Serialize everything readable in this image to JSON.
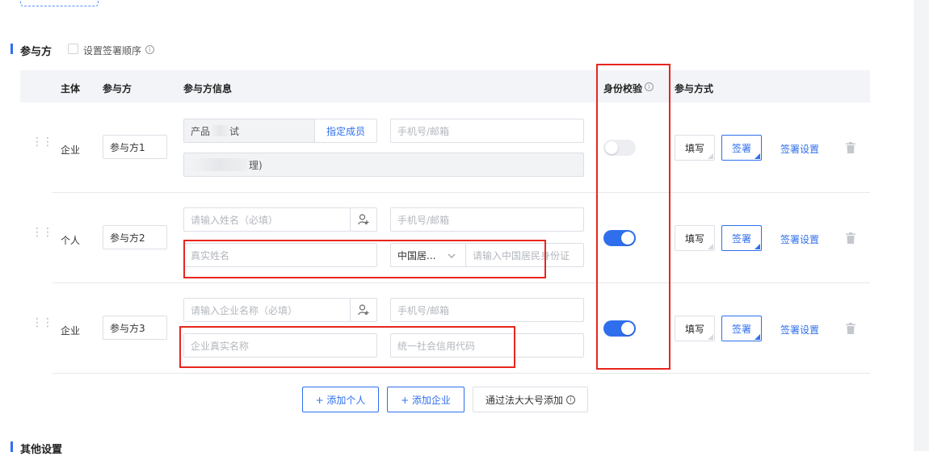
{
  "participants_section": {
    "title": "参与方",
    "order_checkbox_label": "设置签署顺序"
  },
  "table_headers": {
    "subject": "主体",
    "participant": "参与方",
    "participant_info": "参与方信息",
    "id_verify": "身份校验",
    "participation_mode": "参与方式"
  },
  "rows": [
    {
      "subject": "企业",
      "participant_name": "参与方1",
      "org_name_value": "产品",
      "org_name_value_tail": "试",
      "assign_member_label": "指定成员",
      "contact_placeholder": "手机号/邮箱",
      "member_value": "理)",
      "id_verify_on": false,
      "mode_fill_label": "填写",
      "mode_sign_label": "签署",
      "sign_settings_label": "签署设置"
    },
    {
      "subject": "个人",
      "participant_name": "参与方2",
      "name_placeholder": "请输入姓名（必填）",
      "contact_placeholder": "手机号/邮箱",
      "real_name_placeholder": "真实姓名",
      "id_type_value": "中国居...",
      "id_number_placeholder": "请输入中国居民身份证",
      "id_verify_on": true,
      "mode_fill_label": "填写",
      "mode_sign_label": "签署",
      "sign_settings_label": "签署设置"
    },
    {
      "subject": "企业",
      "participant_name": "参与方3",
      "org_placeholder": "请输入企业名称（必填）",
      "contact_placeholder": "手机号/邮箱",
      "real_org_placeholder": "企业真实名称",
      "credit_code_placeholder": "统一社会信用代码",
      "id_verify_on": true,
      "mode_fill_label": "填写",
      "mode_sign_label": "签署",
      "sign_settings_label": "签署设置"
    }
  ],
  "actions": {
    "add_person": "+ 添加个人",
    "add_company": "+ 添加企业",
    "add_via_legal": "通过法大大号添加"
  },
  "other_section": {
    "title": "其他设置"
  },
  "colors": {
    "accent": "#2f6fed",
    "highlight_box": "#e8261e"
  }
}
